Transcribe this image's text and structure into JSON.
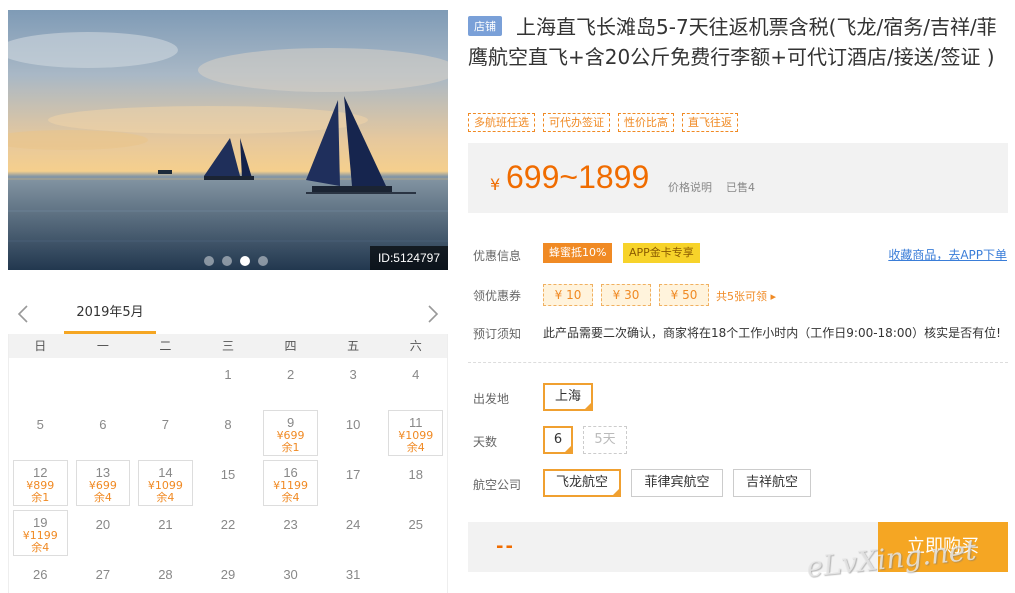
{
  "photo": {
    "id_badge": "ID:5124797",
    "carousel_dots": 4,
    "carousel_active_index": 2
  },
  "calendar": {
    "month_label": "2019年5月",
    "weekdays": [
      "日",
      "一",
      "二",
      "三",
      "四",
      "五",
      "六"
    ],
    "weeks": [
      [
        null,
        null,
        null,
        {
          "day": "1"
        },
        {
          "day": "2"
        },
        {
          "day": "3"
        },
        {
          "day": "4"
        }
      ],
      [
        {
          "day": "5"
        },
        {
          "day": "6"
        },
        {
          "day": "7"
        },
        {
          "day": "8"
        },
        {
          "day": "9",
          "price": "¥699",
          "remain": "余1"
        },
        {
          "day": "10"
        },
        {
          "day": "11",
          "price": "¥1099",
          "remain": "余4"
        }
      ],
      [
        {
          "day": "12",
          "price": "¥899",
          "remain": "余1"
        },
        {
          "day": "13",
          "price": "¥699",
          "remain": "余4"
        },
        {
          "day": "14",
          "price": "¥1099",
          "remain": "余4"
        },
        {
          "day": "15"
        },
        {
          "day": "16",
          "price": "¥1199",
          "remain": "余4"
        },
        {
          "day": "17"
        },
        {
          "day": "18"
        }
      ],
      [
        {
          "day": "19",
          "price": "¥1199",
          "remain": "余4"
        },
        {
          "day": "20"
        },
        {
          "day": "21"
        },
        {
          "day": "22"
        },
        {
          "day": "23"
        },
        {
          "day": "24"
        },
        {
          "day": "25"
        }
      ],
      [
        {
          "day": "26"
        },
        {
          "day": "27"
        },
        {
          "day": "28"
        },
        {
          "day": "29"
        },
        {
          "day": "30"
        },
        {
          "day": "31"
        },
        null
      ]
    ]
  },
  "product": {
    "store_badge": "店铺",
    "title": "上海直飞长滩岛5-7天往返机票含税(飞龙/宿务/吉祥/菲鹰航空直飞+含20公斤免费行李额+可代订酒店/接送/签证 )",
    "tags": [
      "多航班任选",
      "可代办签证",
      "性价比高",
      "直飞往返"
    ],
    "currency": "¥",
    "price_range": "699~1899",
    "price_note": "价格说明",
    "sold": "已售4"
  },
  "info": {
    "promo_label": "优惠信息",
    "promo_tag1": "蜂蜜抵10%",
    "promo_tag2": "APP金卡专享",
    "fav_link": "收藏商品，去APP下单",
    "coupon_label": "领优惠券",
    "coupons": [
      "¥ 10",
      "¥ 30",
      "¥ 50"
    ],
    "coupon_more": "共5张可领 ▸",
    "notice_label": "预订须知",
    "notice_text": "此产品需要二次确认，商家将在18个工作小时内（工作日9:00-18:00）核实是否有位!"
  },
  "options": {
    "departure_label": "出发地",
    "departure_value": "上海",
    "days_label": "天数",
    "days_selected": "6",
    "days_disabled": "5天",
    "airline_label": "航空公司",
    "airlines": [
      "飞龙航空",
      "菲律宾航空",
      "吉祥航空"
    ]
  },
  "buy": {
    "total_placeholder": "--",
    "buy_label": "立即购买",
    "watermark": "eLvXing.net"
  }
}
